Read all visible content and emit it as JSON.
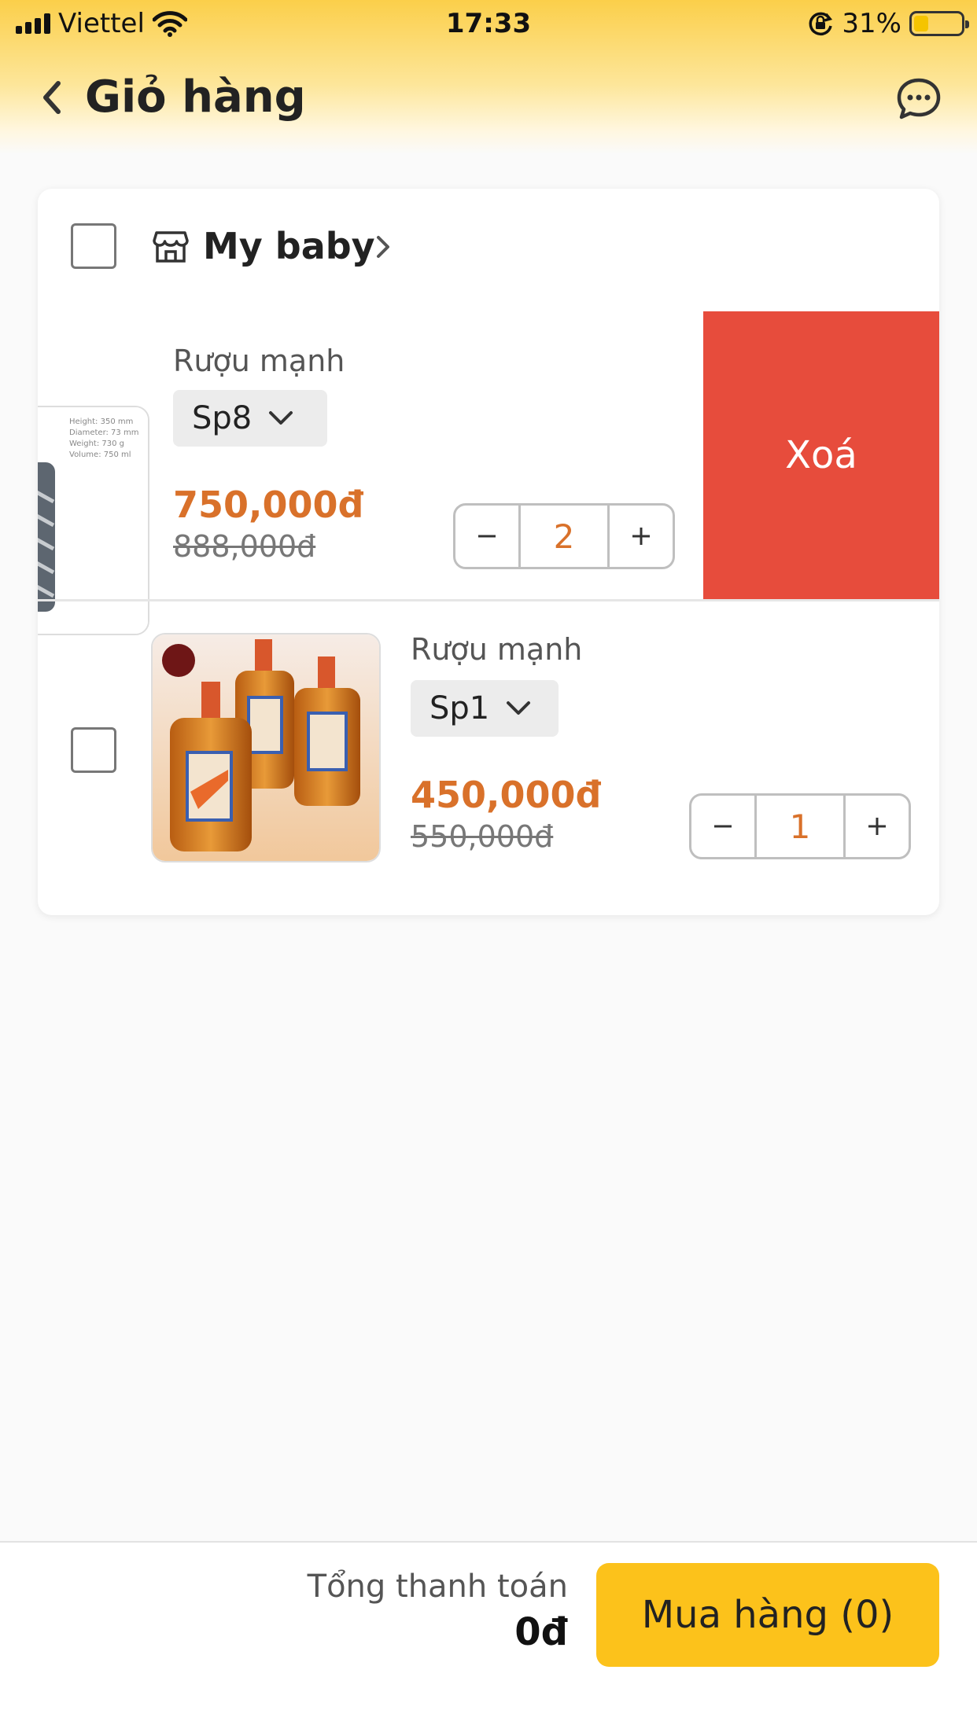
{
  "status_bar": {
    "carrier": "Viettel",
    "time": "17:33",
    "battery": "31%",
    "battery_level": 0.31,
    "icons": [
      "signal-icon",
      "wifi-icon",
      "rotation-lock-icon",
      "battery-icon"
    ]
  },
  "header": {
    "title": "Giỏ hàng",
    "back_icon": "chevron-left-icon",
    "chat_icon": "chat-bubble-icon"
  },
  "shop": {
    "name": "My baby",
    "icon": "store-icon",
    "chevron_icon": "chevron-right-icon"
  },
  "items": [
    {
      "name": "Rượu mạnh",
      "variant": "Sp8",
      "price": "750,000đ",
      "old_price": "888,000đ",
      "quantity": "2",
      "thumbnail_specs": [
        "Height: 350 mm",
        "Diameter: 73 mm",
        "Weight: 730 g",
        "Volume: 750 ml"
      ]
    },
    {
      "name": "Rượu mạnh",
      "variant": "Sp1",
      "price": "450,000đ",
      "old_price": "550,000đ",
      "quantity": "1"
    }
  ],
  "delete_label": "Xoá",
  "stepper": {
    "minus": "−",
    "plus": "+"
  },
  "footer": {
    "total_label": "Tổng thanh toán",
    "total_value": "0đ",
    "buy_label": "Mua hàng (0)"
  },
  "colors": {
    "header_yellow": "#fbcf4a",
    "price_orange": "#d9712a",
    "delete_red": "#e74c3c",
    "buy_yellow": "#fcc21b"
  }
}
